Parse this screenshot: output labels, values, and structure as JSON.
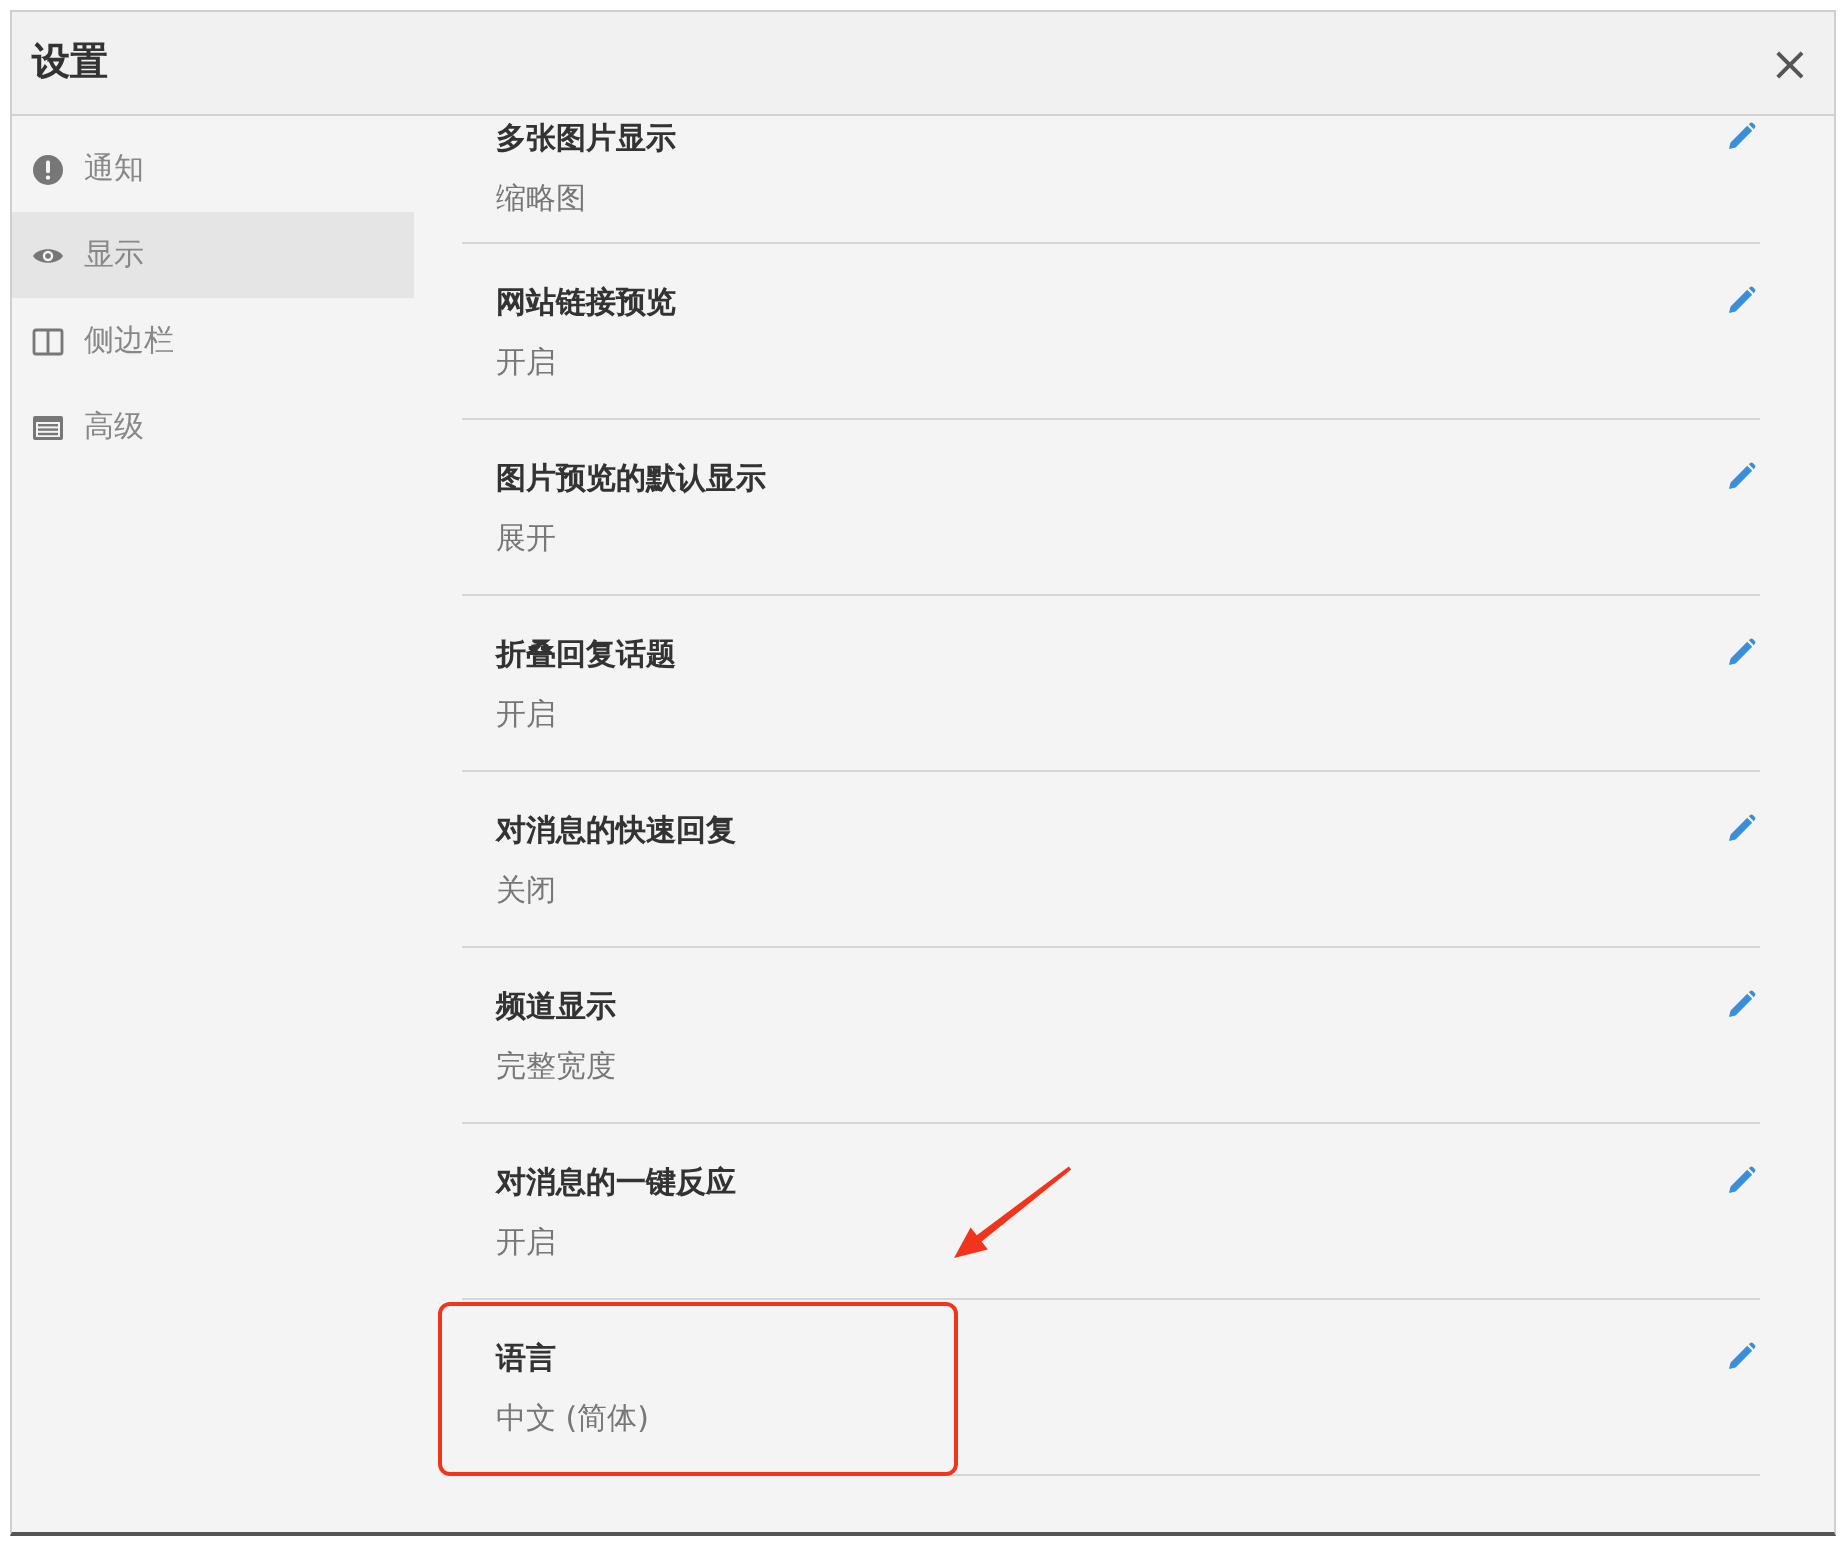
{
  "window": {
    "title": "设置",
    "close": "×"
  },
  "sidebar": {
    "items": [
      {
        "label": "通知",
        "selected": false
      },
      {
        "label": "显示",
        "selected": true
      },
      {
        "label": "侧边栏",
        "selected": false
      },
      {
        "label": "高级",
        "selected": false
      }
    ]
  },
  "settings": [
    {
      "title": "多张图片显示",
      "value": "缩略图",
      "highlighted": false
    },
    {
      "title": "网站链接预览",
      "value": "开启",
      "highlighted": false
    },
    {
      "title": "图片预览的默认显示",
      "value": "展开",
      "highlighted": false
    },
    {
      "title": "折叠回复话题",
      "value": "开启",
      "highlighted": false
    },
    {
      "title": "对消息的快速回复",
      "value": "关闭",
      "highlighted": false
    },
    {
      "title": "频道显示",
      "value": "完整宽度",
      "highlighted": false
    },
    {
      "title": "对消息的一键反应",
      "value": "开启",
      "highlighted": false
    },
    {
      "title": "语言",
      "value": "中文 (简体)",
      "highlighted": true
    }
  ]
}
